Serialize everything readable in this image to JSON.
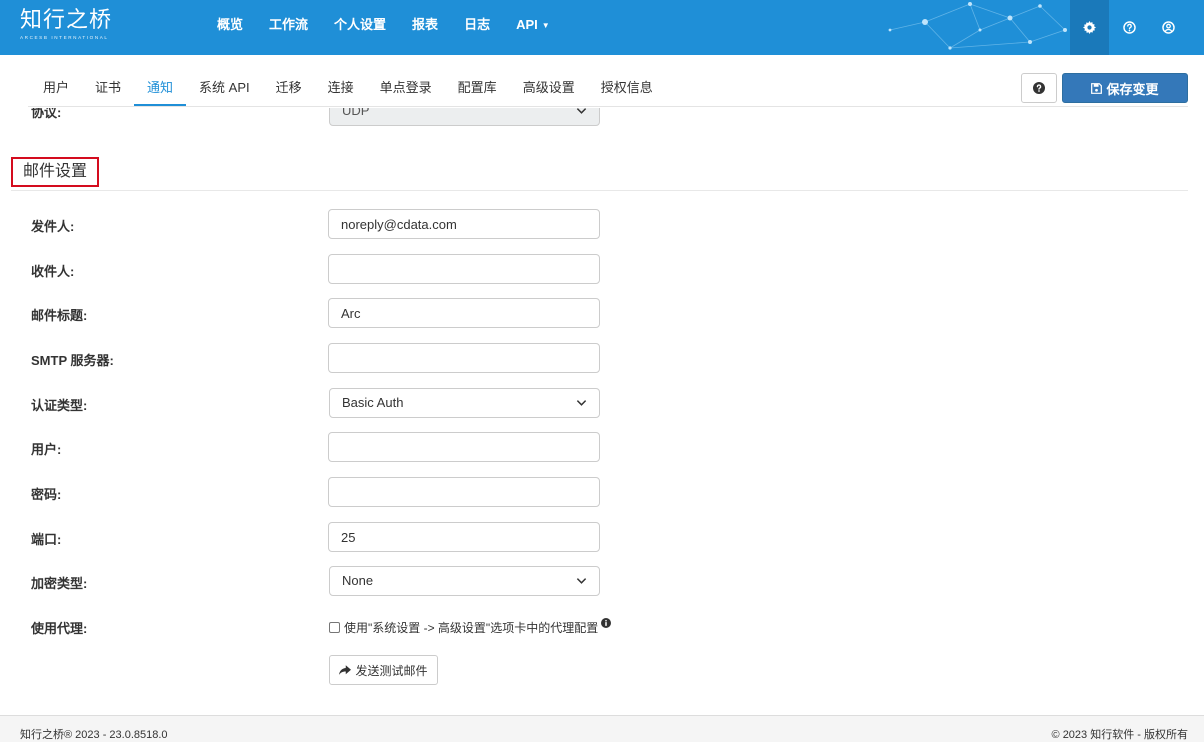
{
  "brand": {
    "logo_text": "知行之桥",
    "logo_subtext": "ARCESB INTERNATIONAL"
  },
  "topnav": {
    "items": [
      {
        "label": "概览"
      },
      {
        "label": "工作流"
      },
      {
        "label": "个人设置"
      },
      {
        "label": "报表"
      },
      {
        "label": "日志"
      },
      {
        "label": "API"
      }
    ],
    "icons": [
      "gear-icon",
      "question-circle-icon",
      "user-circle-icon"
    ]
  },
  "tabs": {
    "items": [
      {
        "label": "用户"
      },
      {
        "label": "证书"
      },
      {
        "label": "通知",
        "active": true
      },
      {
        "label": "系统 API"
      },
      {
        "label": "迁移"
      },
      {
        "label": "连接"
      },
      {
        "label": "单点登录"
      },
      {
        "label": "配置库"
      },
      {
        "label": "高级设置"
      },
      {
        "label": "授权信息"
      }
    ],
    "save_label": "保存变更"
  },
  "protocol": {
    "label": "协议:",
    "value": "UDP"
  },
  "email": {
    "section_title": "邮件设置",
    "sender": {
      "label": "发件人:",
      "value": "noreply@cdata.com"
    },
    "recipient": {
      "label": "收件人:",
      "value": ""
    },
    "subject": {
      "label": "邮件标题:",
      "value": "Arc"
    },
    "smtp": {
      "label": "SMTP 服务器:",
      "value": ""
    },
    "auth_type": {
      "label": "认证类型:",
      "value": "Basic Auth"
    },
    "user": {
      "label": "用户:",
      "value": ""
    },
    "password": {
      "label": "密码:",
      "value": ""
    },
    "port": {
      "label": "端口:",
      "value": "25"
    },
    "encryption": {
      "label": "加密类型:",
      "value": "None"
    },
    "proxy": {
      "label": "使用代理:",
      "checkbox_text": "使用\"系统设置 -> 高级设置\"选项卡中的代理配置",
      "checked": false
    },
    "test_button": "发送测试邮件"
  },
  "footer": {
    "left": "知行之桥® 2023 - 23.0.8518.0",
    "right": "© 2023 知行软件 - 版权所有"
  },
  "colors": {
    "navbar": "#1f8fd7",
    "primary_button": "#3478b9",
    "highlight_border": "#d40c1e"
  }
}
